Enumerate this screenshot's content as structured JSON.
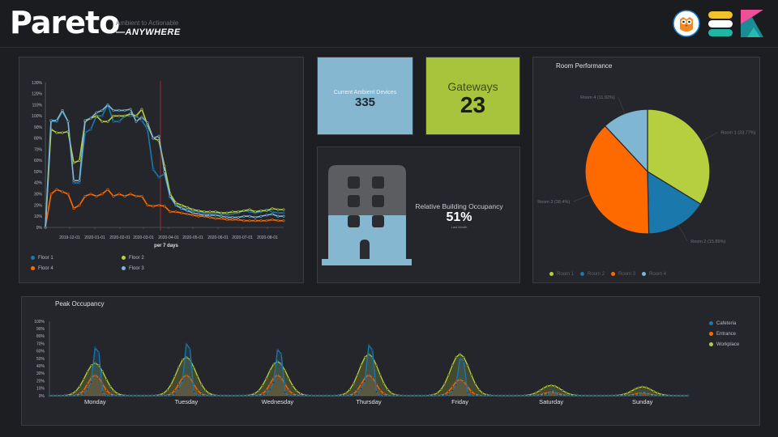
{
  "header": {
    "brand": "Pareto",
    "tagline": "Ambient to Actionable",
    "sub": "—ANYWHERE"
  },
  "colors": {
    "cyan": "#1a78ad",
    "green": "#b6cf3f",
    "orange": "#ff6a00",
    "light_blue": "#7fb7d2",
    "tile_blue": "#86b7d1",
    "tile_green": "#a8c43c"
  },
  "floor_chart": {
    "xlabel": "per 7 days",
    "y_ticks": [
      "0%",
      "10%",
      "20%",
      "30%",
      "40%",
      "50%",
      "60%",
      "70%",
      "80%",
      "90%",
      "100%",
      "110%",
      "120%",
      "130%"
    ],
    "x_ticks": [
      "2019-12-01",
      "2020-01-01",
      "2020-02-01",
      "2020-03-01",
      "2020-04-01",
      "2020-05-01",
      "2020-06-01",
      "2020-07-01",
      "2020-08-01"
    ],
    "legend": [
      "Floor 1",
      "Floor 2",
      "Floor 4",
      "Floor 3"
    ]
  },
  "ambient_tile": {
    "label": "Current Ambient Devices",
    "value": "335"
  },
  "gateways_tile": {
    "label": "Gateways",
    "value": "23"
  },
  "occupancy_tile": {
    "label": "Relative Building Occupancy",
    "value": "51%",
    "sub": "Last Month"
  },
  "room_chart": {
    "title": "Room Performance",
    "slices": [
      {
        "label": "Room 1 (33.77%)",
        "legend": "Room 1",
        "value": 33.77
      },
      {
        "label": "Room 2 (15.89%)",
        "legend": "Room 2",
        "value": 15.89
      },
      {
        "label": "Room 3 (38.4%)",
        "legend": "Room 3",
        "value": 38.4
      },
      {
        "label": "Room 4 (11.92%)",
        "legend": "Room 4",
        "value": 11.92
      }
    ]
  },
  "peak_chart": {
    "title": "Peak Occupancy",
    "y_ticks": [
      "0%",
      "10%",
      "20%",
      "30%",
      "40%",
      "50%",
      "60%",
      "70%",
      "80%",
      "90%",
      "100%"
    ],
    "days": [
      "Monday",
      "Tuesday",
      "Wednesday",
      "Thursday",
      "Friday",
      "Saturday",
      "Sunday"
    ],
    "legend": [
      "Cafeteria",
      "Entrance",
      "Workplace"
    ]
  },
  "chart_data": [
    {
      "type": "line",
      "xlabel": "per 7 days",
      "ylim": [
        0,
        130
      ],
      "x": [
        "2019-11-01",
        "2019-11-08",
        "2019-11-15",
        "2019-11-22",
        "2019-11-29",
        "2019-12-06",
        "2019-12-13",
        "2019-12-20",
        "2019-12-27",
        "2020-01-03",
        "2020-01-10",
        "2020-01-17",
        "2020-01-24",
        "2020-01-31",
        "2020-02-07",
        "2020-02-14",
        "2020-02-21",
        "2020-02-28",
        "2020-03-06",
        "2020-03-13",
        "2020-03-20",
        "2020-03-27",
        "2020-04-03",
        "2020-04-10",
        "2020-04-17",
        "2020-04-24",
        "2020-05-01",
        "2020-05-08",
        "2020-05-15",
        "2020-05-22",
        "2020-05-29",
        "2020-06-05",
        "2020-06-12",
        "2020-06-19",
        "2020-06-26",
        "2020-07-03",
        "2020-07-10",
        "2020-07-17",
        "2020-07-24",
        "2020-07-31",
        "2020-08-07",
        "2020-08-14",
        "2020-08-21"
      ],
      "series": [
        {
          "name": "Floor 1",
          "values": [
            0,
            95,
            95,
            104,
            95,
            40,
            40,
            85,
            88,
            100,
            100,
            110,
            95,
            95,
            100,
            100,
            100,
            96,
            88,
            52,
            45,
            48,
            27,
            20,
            18,
            16,
            15,
            14,
            13,
            12,
            13,
            12,
            11,
            12,
            13,
            15,
            14,
            13,
            14,
            16,
            14,
            13,
            13
          ]
        },
        {
          "name": "Floor 2",
          "values": [
            0,
            88,
            85,
            85,
            86,
            58,
            60,
            95,
            98,
            100,
            95,
            95,
            100,
            100,
            100,
            102,
            100,
            106,
            92,
            80,
            78,
            55,
            30,
            22,
            20,
            18,
            16,
            15,
            14,
            14,
            14,
            13,
            13,
            14,
            14,
            15,
            16,
            14,
            15,
            15,
            17,
            16,
            16
          ]
        },
        {
          "name": "Floor 4",
          "values": [
            0,
            30,
            34,
            32,
            30,
            17,
            20,
            28,
            30,
            28,
            30,
            34,
            28,
            30,
            28,
            30,
            28,
            28,
            20,
            19,
            20,
            19,
            14,
            14,
            13,
            12,
            11,
            10,
            10,
            9,
            8,
            8,
            7,
            7,
            7,
            6,
            6,
            6,
            6,
            6,
            7,
            6,
            6
          ]
        },
        {
          "name": "Floor 3",
          "values": [
            0,
            96,
            96,
            105,
            95,
            42,
            42,
            96,
            98,
            103,
            105,
            110,
            105,
            105,
            105,
            106,
            95,
            99,
            94,
            80,
            82,
            50,
            28,
            20,
            17,
            15,
            13,
            12,
            11,
            11,
            11,
            10,
            9,
            9,
            9,
            10,
            10,
            9,
            10,
            11,
            12,
            10,
            10
          ]
        }
      ]
    },
    {
      "type": "pie",
      "title": "Room Performance",
      "categories": [
        "Room 1",
        "Room 2",
        "Room 3",
        "Room 4"
      ],
      "values": [
        33.77,
        15.89,
        38.4,
        11.92
      ]
    },
    {
      "type": "area",
      "title": "Peak Occupancy",
      "ylim": [
        0,
        100
      ],
      "categories": [
        "Monday",
        "Tuesday",
        "Wednesday",
        "Thursday",
        "Friday",
        "Saturday",
        "Sunday"
      ],
      "series": [
        {
          "name": "Cafeteria",
          "peaks": [
            76,
            82,
            73,
            80,
            60,
            8,
            6
          ]
        },
        {
          "name": "Entrance",
          "peaks": [
            28,
            28,
            28,
            28,
            22,
            5,
            4
          ]
        },
        {
          "name": "Workplace",
          "peaks": [
            44,
            52,
            46,
            56,
            56,
            14,
            12
          ]
        }
      ]
    }
  ]
}
